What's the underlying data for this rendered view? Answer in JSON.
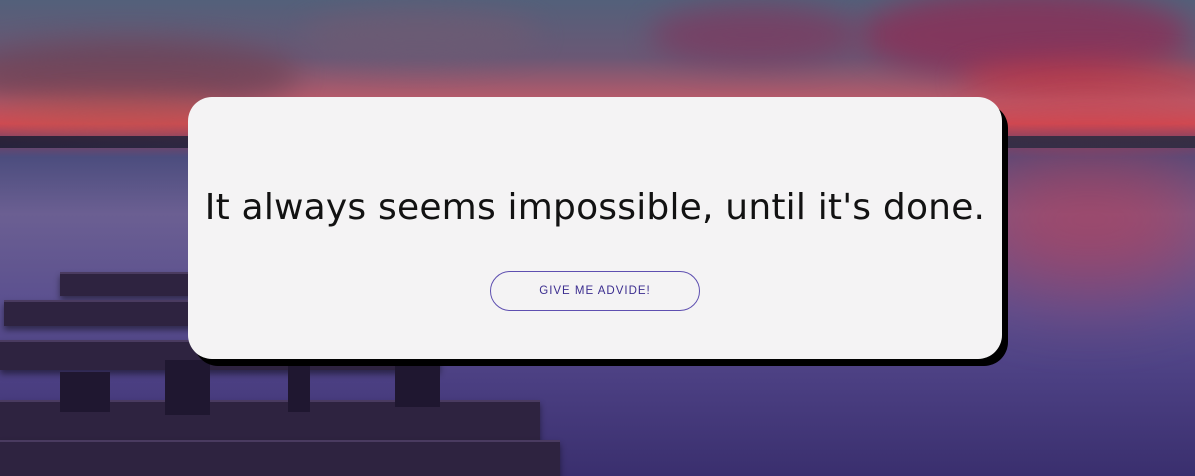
{
  "quote": {
    "text": "It always seems impossible, until it's done."
  },
  "actions": {
    "advice_button_label": "GIVE ME ADVIDE!"
  },
  "colors": {
    "card_background": "#f4f3f4",
    "button_accent": "#5e4fb0",
    "button_text": "#3b2d8f",
    "quote_text": "#121212"
  }
}
